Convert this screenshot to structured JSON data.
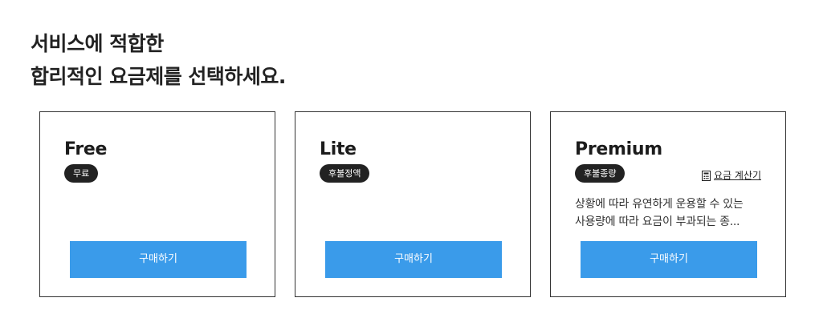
{
  "heading": {
    "line1": "서비스에 적합한",
    "line2": "합리적인 요금제를 선택하세요."
  },
  "plans": [
    {
      "name": "Free",
      "badge": "무료",
      "buy_label": "구매하기"
    },
    {
      "name": "Lite",
      "badge": "후불정액",
      "buy_label": "구매하기"
    },
    {
      "name": "Premium",
      "badge": "후불종량",
      "calculator_label": "요금 계산기",
      "calculator_icon": "calculator-icon",
      "description_line1": "상황에 따라 유연하게 운용할 수 있는",
      "description_line2": "사용량에 따라 요금이 부과되는 종...",
      "buy_label": "구매하기"
    }
  ],
  "colors": {
    "button": "#3a9bea",
    "badge": "#222222",
    "border": "#333333"
  }
}
